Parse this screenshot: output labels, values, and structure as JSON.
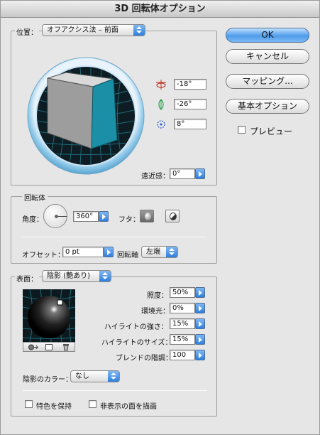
{
  "window": {
    "title": "3D 回転体オプション"
  },
  "position": {
    "label": "位置：",
    "preset": "オフアクシス法 – 前面",
    "x_angle": "-18°",
    "y_angle": "-26°",
    "z_angle": "8°",
    "perspective_label": "遠近感：",
    "perspective_value": "0°",
    "cube_face_color": "#1a8fa6"
  },
  "revolve": {
    "group_label": "回転体",
    "angle_label": "角度：",
    "angle_value": "360°",
    "cap_label": "フタ：",
    "offset_label": "オフセット：",
    "offset_value": "0 pt",
    "axis_label": "回転軸",
    "axis_value": "左端"
  },
  "surface": {
    "label": "表面：",
    "value": "陰影 (艶あり)",
    "light_intensity_label": "照度：",
    "light_intensity_value": "50%",
    "ambient_label": "環境光：",
    "ambient_value": "0%",
    "highlight_intensity_label": "ハイライトの強さ：",
    "highlight_intensity_value": "15%",
    "highlight_size_label": "ハイライトのサイズ：",
    "highlight_size_value": "15%",
    "blend_steps_label": "ブレンドの階調：",
    "blend_steps_value": "100",
    "shading_color_label": "陰影のカラー：",
    "shading_color_value": "なし",
    "preserve_spot_label": "特色を保持",
    "draw_hidden_label": "非表示の面を描画"
  },
  "buttons": {
    "ok": "OK",
    "cancel": "キャンセル",
    "map": "マッピング...",
    "fewer_options": "基本オプション",
    "preview_label": "プレビュー"
  }
}
